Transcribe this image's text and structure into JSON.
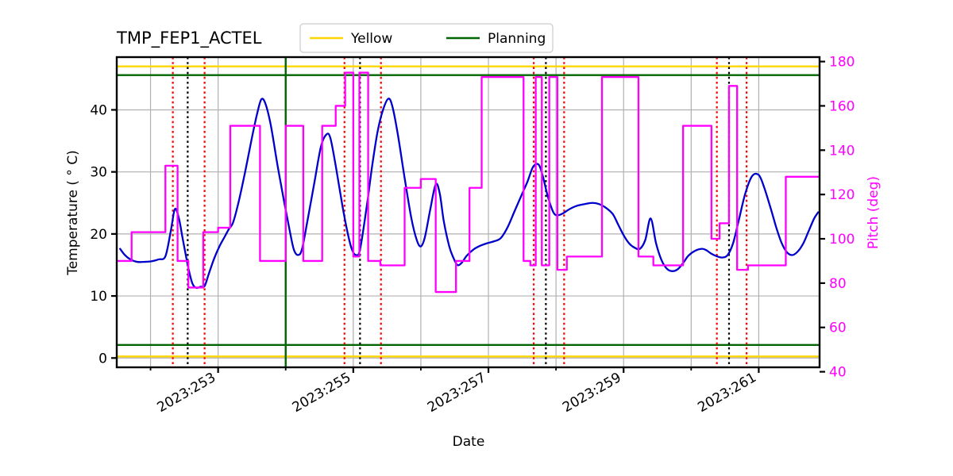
{
  "chart_data": {
    "type": "line",
    "title": "TMP_FEP1_ACTEL",
    "xlabel": "Date",
    "ylabel": "Temperature ( ° C)",
    "ylabel_right": "Pitch (deg)",
    "grid": true,
    "legend_position": "top-center",
    "legend": [
      {
        "label": "Yellow",
        "color": "#FFD700"
      },
      {
        "label": "Planning",
        "color": "#006400"
      }
    ],
    "xlim": [
      251.5,
      261.9
    ],
    "ylim": [
      -1.5,
      48.5
    ],
    "ylim_right": [
      42.0,
      182.0
    ],
    "xticks_major": [
      253,
      255,
      257,
      259,
      261
    ],
    "xticklabels": [
      "2023:253",
      "2023:255",
      "2023:257",
      "2023:259",
      "2023:261"
    ],
    "xticks_minor": [
      252,
      254,
      256,
      258,
      260
    ],
    "yticks": [
      0,
      10,
      20,
      30,
      40
    ],
    "yticklabels": [
      "0",
      "10",
      "20",
      "30",
      "40"
    ],
    "yticks_right": [
      40,
      60,
      80,
      100,
      120,
      140,
      160,
      180
    ],
    "yticklabels_right": [
      "40",
      "60",
      "80",
      "100",
      "120",
      "140",
      "160",
      "180"
    ],
    "hlines": [
      {
        "name": "yellow-limit-upper",
        "y": 47.0,
        "color": "#FFD700",
        "width": 2.4
      },
      {
        "name": "yellow-limit-lower",
        "y": 0.25,
        "color": "#FFD700",
        "width": 2.4
      },
      {
        "name": "planning-limit-upper",
        "y": 45.6,
        "color": "#006400",
        "width": 2.4
      },
      {
        "name": "planning-limit-lower",
        "y": 2.1,
        "color": "#006400",
        "width": 2.4
      }
    ],
    "vlines": [
      {
        "name": "green-event",
        "x": 254.0,
        "color": "#006400",
        "style": "solid",
        "width": 2.4
      },
      {
        "name": "red-event",
        "x": 252.33,
        "color": "#ff0000",
        "style": "dotted",
        "width": 2.2
      },
      {
        "name": "black-event",
        "x": 252.55,
        "color": "#000000",
        "style": "dotted",
        "width": 2.2
      },
      {
        "name": "red-event",
        "x": 252.8,
        "color": "#ff0000",
        "style": "dotted",
        "width": 2.2
      },
      {
        "name": "red-event",
        "x": 254.87,
        "color": "#ff0000",
        "style": "dotted",
        "width": 2.2
      },
      {
        "name": "black-event",
        "x": 255.1,
        "color": "#000000",
        "style": "dotted",
        "width": 2.2
      },
      {
        "name": "red-event",
        "x": 255.41,
        "color": "#ff0000",
        "style": "dotted",
        "width": 2.2
      },
      {
        "name": "red-event",
        "x": 257.67,
        "color": "#ff0000",
        "style": "dotted",
        "width": 2.2
      },
      {
        "name": "black-event",
        "x": 257.85,
        "color": "#000000",
        "style": "dotted",
        "width": 2.2
      },
      {
        "name": "red-event",
        "x": 258.12,
        "color": "#ff0000",
        "style": "dotted",
        "width": 2.2
      },
      {
        "name": "red-event",
        "x": 260.38,
        "color": "#ff0000",
        "style": "dotted",
        "width": 2.2
      },
      {
        "name": "black-event",
        "x": 260.56,
        "color": "#000000",
        "style": "dotted",
        "width": 2.2
      },
      {
        "name": "red-event",
        "x": 260.82,
        "color": "#ff0000",
        "style": "dotted",
        "width": 2.2
      }
    ],
    "series": [
      {
        "name": "temperature",
        "axis": "left",
        "color": "#0000CC",
        "width": 2.3,
        "style": "smooth",
        "points": [
          [
            251.55,
            17.6
          ],
          [
            251.62,
            16.6
          ],
          [
            251.7,
            15.9
          ],
          [
            251.8,
            15.5
          ],
          [
            251.92,
            15.5
          ],
          [
            252.02,
            15.6
          ],
          [
            252.12,
            15.9
          ],
          [
            252.22,
            16.4
          ],
          [
            252.3,
            20.5
          ],
          [
            252.36,
            24.0
          ],
          [
            252.42,
            22.5
          ],
          [
            252.48,
            19.0
          ],
          [
            252.56,
            14.5
          ],
          [
            252.62,
            12.0
          ],
          [
            252.68,
            11.3
          ],
          [
            252.74,
            11.5
          ],
          [
            252.8,
            11.6
          ],
          [
            252.86,
            13.5
          ],
          [
            252.94,
            16.0
          ],
          [
            253.02,
            18.0
          ],
          [
            253.1,
            19.6
          ],
          [
            253.16,
            20.8
          ],
          [
            253.22,
            21.8
          ],
          [
            253.3,
            25.0
          ],
          [
            253.4,
            30.0
          ],
          [
            253.5,
            35.5
          ],
          [
            253.58,
            39.5
          ],
          [
            253.64,
            41.7
          ],
          [
            253.7,
            41.0
          ],
          [
            253.78,
            37.5
          ],
          [
            253.88,
            31.0
          ],
          [
            253.98,
            25.0
          ],
          [
            254.06,
            20.5
          ],
          [
            254.12,
            17.5
          ],
          [
            254.18,
            16.6
          ],
          [
            254.24,
            17.5
          ],
          [
            254.32,
            22.0
          ],
          [
            254.42,
            28.0
          ],
          [
            254.52,
            34.0
          ],
          [
            254.6,
            36.0
          ],
          [
            254.66,
            35.5
          ],
          [
            254.74,
            31.0
          ],
          [
            254.84,
            24.5
          ],
          [
            254.92,
            20.0
          ],
          [
            254.98,
            17.5
          ],
          [
            255.04,
            16.6
          ],
          [
            255.1,
            17.5
          ],
          [
            255.2,
            24.5
          ],
          [
            255.28,
            31.0
          ],
          [
            255.36,
            36.5
          ],
          [
            255.44,
            40.0
          ],
          [
            255.52,
            41.8
          ],
          [
            255.58,
            40.5
          ],
          [
            255.66,
            36.0
          ],
          [
            255.76,
            29.0
          ],
          [
            255.86,
            22.5
          ],
          [
            255.94,
            19.0
          ],
          [
            256.0,
            18.0
          ],
          [
            256.06,
            19.5
          ],
          [
            256.14,
            24.0
          ],
          [
            256.22,
            28.0
          ],
          [
            256.28,
            26.5
          ],
          [
            256.34,
            22.0
          ],
          [
            256.42,
            18.0
          ],
          [
            256.48,
            16.2
          ],
          [
            256.54,
            15.0
          ],
          [
            256.6,
            15.3
          ],
          [
            256.68,
            16.5
          ],
          [
            256.78,
            17.5
          ],
          [
            256.88,
            18.1
          ],
          [
            256.98,
            18.5
          ],
          [
            257.08,
            18.8
          ],
          [
            257.18,
            19.3
          ],
          [
            257.28,
            21.0
          ],
          [
            257.38,
            23.5
          ],
          [
            257.48,
            26.0
          ],
          [
            257.58,
            28.5
          ],
          [
            257.66,
            30.8
          ],
          [
            257.74,
            31.2
          ],
          [
            257.8,
            29.5
          ],
          [
            257.88,
            26.0
          ],
          [
            257.96,
            23.5
          ],
          [
            258.02,
            23.0
          ],
          [
            258.1,
            23.3
          ],
          [
            258.2,
            24.0
          ],
          [
            258.3,
            24.5
          ],
          [
            258.42,
            24.8
          ],
          [
            258.54,
            25.0
          ],
          [
            258.64,
            24.8
          ],
          [
            258.74,
            24.2
          ],
          [
            258.84,
            23.2
          ],
          [
            258.92,
            21.5
          ],
          [
            259.0,
            19.8
          ],
          [
            259.08,
            18.5
          ],
          [
            259.16,
            17.8
          ],
          [
            259.24,
            17.6
          ],
          [
            259.32,
            19.0
          ],
          [
            259.4,
            22.5
          ],
          [
            259.48,
            18.5
          ],
          [
            259.56,
            15.8
          ],
          [
            259.64,
            14.4
          ],
          [
            259.72,
            14.0
          ],
          [
            259.8,
            14.3
          ],
          [
            259.88,
            15.3
          ],
          [
            259.96,
            16.5
          ],
          [
            260.06,
            17.3
          ],
          [
            260.16,
            17.6
          ],
          [
            260.22,
            17.4
          ],
          [
            260.3,
            16.8
          ],
          [
            260.38,
            16.4
          ],
          [
            260.46,
            16.2
          ],
          [
            260.54,
            16.6
          ],
          [
            260.62,
            18.5
          ],
          [
            260.7,
            22.0
          ],
          [
            260.8,
            26.5
          ],
          [
            260.9,
            29.3
          ],
          [
            261.0,
            29.5
          ],
          [
            261.08,
            27.5
          ],
          [
            261.18,
            24.0
          ],
          [
            261.26,
            21.0
          ],
          [
            261.34,
            18.5
          ],
          [
            261.42,
            17.0
          ],
          [
            261.5,
            16.6
          ],
          [
            261.58,
            17.2
          ],
          [
            261.66,
            18.5
          ],
          [
            261.74,
            20.5
          ],
          [
            261.82,
            22.5
          ],
          [
            261.88,
            23.5
          ]
        ]
      },
      {
        "name": "pitch",
        "axis": "right",
        "color": "#FF00FF",
        "width": 2.3,
        "style": "step",
        "points": [
          [
            251.52,
            90
          ],
          [
            251.72,
            90
          ],
          [
            251.72,
            103
          ],
          [
            252.22,
            103
          ],
          [
            252.22,
            133
          ],
          [
            252.4,
            133
          ],
          [
            252.4,
            90
          ],
          [
            252.56,
            90
          ],
          [
            252.56,
            78
          ],
          [
            252.78,
            78
          ],
          [
            252.78,
            103
          ],
          [
            253.0,
            103
          ],
          [
            253.0,
            105
          ],
          [
            253.18,
            105
          ],
          [
            253.18,
            151
          ],
          [
            253.62,
            151
          ],
          [
            253.62,
            90
          ],
          [
            254.0,
            90
          ],
          [
            254.0,
            151
          ],
          [
            254.26,
            151
          ],
          [
            254.26,
            90
          ],
          [
            254.54,
            90
          ],
          [
            254.54,
            151
          ],
          [
            254.74,
            151
          ],
          [
            254.74,
            160
          ],
          [
            254.88,
            160
          ],
          [
            254.88,
            175
          ],
          [
            255.0,
            175
          ],
          [
            255.0,
            92
          ],
          [
            255.09,
            92
          ],
          [
            255.09,
            175
          ],
          [
            255.22,
            175
          ],
          [
            255.22,
            90
          ],
          [
            255.4,
            90
          ],
          [
            255.4,
            88
          ],
          [
            255.76,
            88
          ],
          [
            255.76,
            123
          ],
          [
            256.0,
            123
          ],
          [
            256.0,
            127
          ],
          [
            256.22,
            127
          ],
          [
            256.22,
            76
          ],
          [
            256.52,
            76
          ],
          [
            256.52,
            90
          ],
          [
            256.72,
            90
          ],
          [
            256.72,
            123
          ],
          [
            256.9,
            123
          ],
          [
            256.9,
            173
          ],
          [
            257.28,
            173
          ],
          [
            257.28,
            173
          ],
          [
            257.52,
            173
          ],
          [
            257.52,
            90
          ],
          [
            257.62,
            90
          ],
          [
            257.62,
            88
          ],
          [
            257.7,
            88
          ],
          [
            257.7,
            173
          ],
          [
            257.79,
            173
          ],
          [
            257.79,
            88
          ],
          [
            257.9,
            88
          ],
          [
            257.9,
            173
          ],
          [
            258.02,
            173
          ],
          [
            258.02,
            86
          ],
          [
            258.16,
            86
          ],
          [
            258.16,
            92
          ],
          [
            258.68,
            92
          ],
          [
            258.68,
            173
          ],
          [
            259.0,
            173
          ],
          [
            259.0,
            173
          ],
          [
            259.22,
            173
          ],
          [
            259.22,
            92
          ],
          [
            259.44,
            92
          ],
          [
            259.44,
            88
          ],
          [
            259.72,
            88
          ],
          [
            259.72,
            88
          ],
          [
            259.88,
            88
          ],
          [
            259.88,
            151
          ],
          [
            260.14,
            151
          ],
          [
            260.14,
            151
          ],
          [
            260.3,
            151
          ],
          [
            260.3,
            100
          ],
          [
            260.42,
            100
          ],
          [
            260.42,
            107
          ],
          [
            260.56,
            107
          ],
          [
            260.56,
            169
          ],
          [
            260.68,
            169
          ],
          [
            260.68,
            86
          ],
          [
            260.84,
            86
          ],
          [
            260.84,
            88
          ],
          [
            261.12,
            88
          ],
          [
            261.12,
            88
          ],
          [
            261.4,
            88
          ],
          [
            261.4,
            128
          ],
          [
            261.62,
            128
          ],
          [
            261.62,
            128
          ],
          [
            261.88,
            128
          ]
        ]
      }
    ]
  }
}
